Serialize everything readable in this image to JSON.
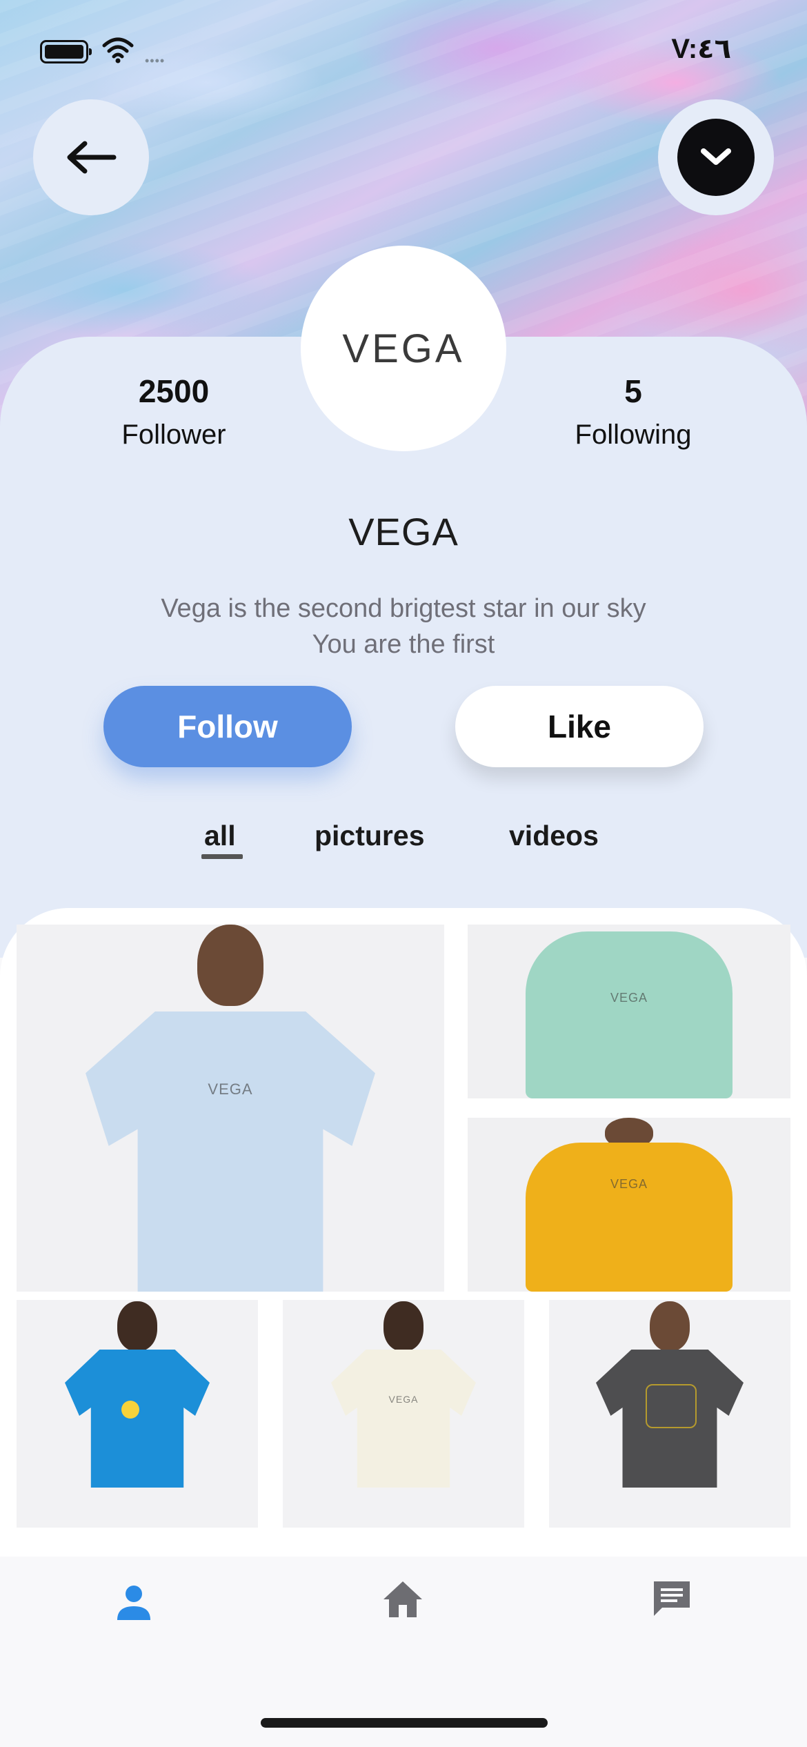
{
  "status_bar": {
    "time": "V:٤٦",
    "signal_dots": "••••"
  },
  "header": {
    "back_icon": "arrow-left-icon",
    "more_icon": "chevron-down-icon"
  },
  "profile": {
    "avatar_text": "VEGA",
    "followers": {
      "count": "2500",
      "label": "Follower"
    },
    "following": {
      "count": "5",
      "label": "Following"
    },
    "name": "VEGA",
    "bio_line1": "Vega is the second brigtest star in our sky",
    "bio_line2": "You are the first"
  },
  "actions": {
    "follow_label": "Follow",
    "like_label": "Like"
  },
  "tabs": {
    "all": "all",
    "pictures": "pictures",
    "videos": "videos",
    "active": "all"
  },
  "gallery": {
    "items": [
      {
        "desc": "light blue VEGA t-shirt",
        "logo": "VEGA"
      },
      {
        "desc": "mint VEGA hoodie",
        "logo": "VEGA"
      },
      {
        "desc": "yellow VEGA hoodie",
        "logo": "VEGA"
      },
      {
        "desc": "blue printed t-shirt",
        "logo": ""
      },
      {
        "desc": "cream VEGA t-shirt",
        "logo": "VEGA"
      },
      {
        "desc": "charcoal printed t-shirt",
        "logo": ""
      }
    ]
  },
  "bottom_nav": {
    "items": [
      {
        "icon": "person-icon",
        "active": true
      },
      {
        "icon": "home-icon",
        "active": false
      },
      {
        "icon": "chat-icon",
        "active": false
      }
    ],
    "active_color": "#2b8be6",
    "inactive_color": "#6d6d72"
  },
  "colors": {
    "accent": "#5b8fe2",
    "card_bg": "#e4ebf8"
  }
}
